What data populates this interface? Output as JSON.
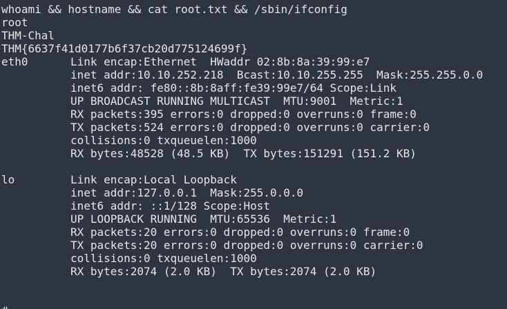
{
  "command": "whoami && hostname && cat root.txt && /sbin/ifconfig",
  "output": {
    "user": "root",
    "hostname": "THM-Chal",
    "flag": "THM{6637f41d0177b6f37cb20d775124699f}"
  },
  "interfaces": [
    {
      "name": "eth0",
      "lines": [
        "Link encap:Ethernet  HWaddr 02:8b:8a:39:99:e7",
        "inet addr:10.10.252.218  Bcast:10.10.255.255  Mask:255.255.0.0",
        "inet6 addr: fe80::8b:8aff:fe39:99e7/64 Scope:Link",
        "UP BROADCAST RUNNING MULTICAST  MTU:9001  Metric:1",
        "RX packets:395 errors:0 dropped:0 overruns:0 frame:0",
        "TX packets:524 errors:0 dropped:0 overruns:0 carrier:0",
        "collisions:0 txqueuelen:1000",
        "RX bytes:48528 (48.5 KB)  TX bytes:151291 (151.2 KB)"
      ]
    },
    {
      "name": "lo",
      "lines": [
        "Link encap:Local Loopback",
        "inet addr:127.0.0.1  Mask:255.0.0.0",
        "inet6 addr: ::1/128 Scope:Host",
        "UP LOOPBACK RUNNING  MTU:65536  Metric:1",
        "RX packets:20 errors:0 dropped:0 overruns:0 frame:0",
        "TX packets:20 errors:0 dropped:0 overruns:0 carrier:0",
        "collisions:0 txqueuelen:1000",
        "RX bytes:2074 (2.0 KB)  TX bytes:2074 (2.0 KB)"
      ]
    }
  ],
  "prompt": "#",
  "colors": {
    "background": "#2e3440",
    "foreground": "#e6e6e6"
  }
}
